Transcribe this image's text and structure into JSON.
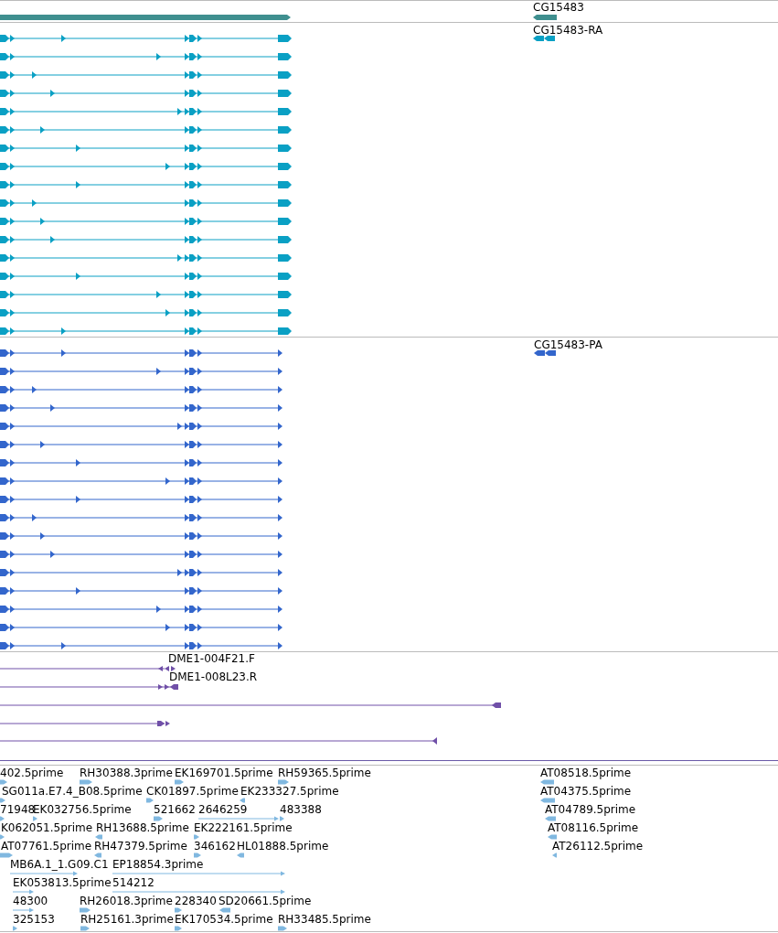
{
  "gene": {
    "label": "CG15483"
  },
  "transcripts": [
    {
      "label": "CG15483-RA"
    },
    {
      "label": "CG15483-PA"
    }
  ],
  "clones": [
    {
      "label": "DME1-004F21.F"
    },
    {
      "label": "DME1-008L23.R"
    }
  ],
  "est_rows": [
    [
      "402.5prime",
      "RH30388.3prime",
      "EK169701.5prime",
      "RH59365.5prime",
      "AT08518.5prime"
    ],
    [
      "SG011a.E7.4_B08.5prime",
      "CK01897.5prime",
      "EK233327.5prime",
      "AT04375.5prime"
    ],
    [
      "71948",
      "EK032756.5prime",
      "521662",
      "2646259",
      "483388",
      "AT04789.5prime"
    ],
    [
      "K062051.5prime",
      "RH13688.5prime",
      "EK222161.5prime",
      "AT08116.5prime"
    ],
    [
      "AT07761.5prime",
      "RH47379.5prime",
      "346162",
      "HL01888.5prime",
      "AT26112.5prime"
    ],
    [
      "MB6A.1_1.G09.C1",
      "EP18854.3prime"
    ],
    [
      "EK053813.5prime",
      "514212"
    ],
    [
      "48300",
      "RH26018.3prime",
      "228340",
      "SD20661.5prime"
    ],
    [
      "325153",
      "RH25161.3prime",
      "EK170534.5prime",
      "RH33485.5prime"
    ]
  ]
}
